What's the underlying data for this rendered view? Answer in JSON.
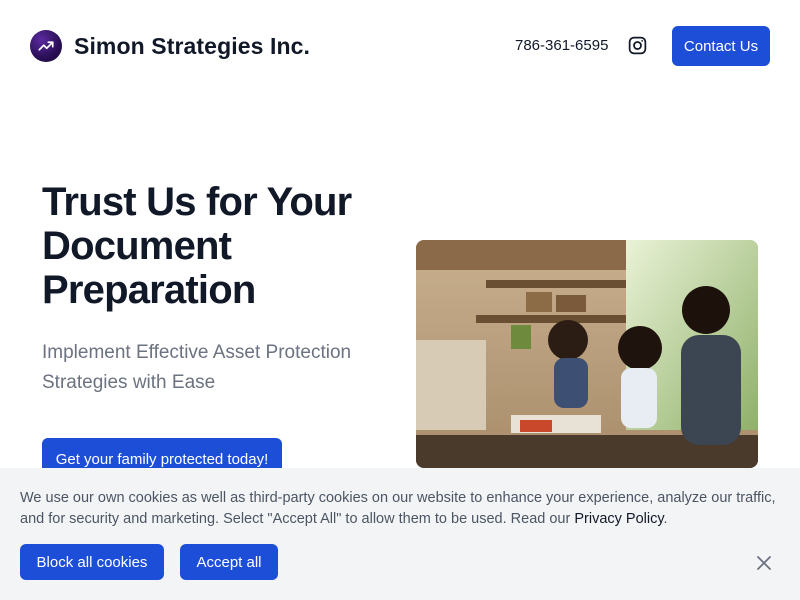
{
  "header": {
    "logo_icon": "trending-up-icon",
    "brand": "Simon Strategies Inc.",
    "phone": "786-361-6595",
    "instagram_icon": "instagram-icon",
    "contact_label": "Contact Us"
  },
  "hero": {
    "title": "Trust Us for Your Document Preparation",
    "subtitle": "Implement Effective Asset Protection Strategies with Ease",
    "cta_label": "Get your family protected today!",
    "image_icon": "family-kitchen-photo"
  },
  "cookie": {
    "text": "We use our own cookies as well as third-party cookies on our website to enhance your experience, analyze our traffic, and for security and marketing. Select \"Accept All\" to allow them to be used. Read our ",
    "link_text": "Privacy Policy",
    "trailing": ".",
    "block_label": "Block all cookies",
    "accept_label": "Accept all",
    "close_icon": "close-icon"
  },
  "colors": {
    "accent": "#1d4ed8",
    "text": "#111827",
    "muted": "#6b7280",
    "cookie_bg": "#f3f4f6"
  }
}
